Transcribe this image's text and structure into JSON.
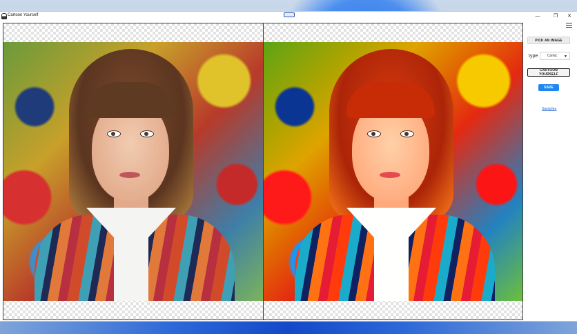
{
  "window": {
    "title": "Cartoon Yourself",
    "controls": {
      "minimize": "—",
      "maximize": "❐",
      "close": "✕"
    }
  },
  "images": {
    "original": "original-photo",
    "cartoon": "cartoonized-photo"
  },
  "sidebar": {
    "pick_label": "PICK AN IMAGE",
    "type_label": "type",
    "type_value": "Comic",
    "cartoon_label": "CARTOON YOURSELF",
    "save_label": "SAVE",
    "samples_label": "Samples"
  },
  "colors": {
    "accent": "#1e88f0",
    "link": "#1a5fd0"
  }
}
